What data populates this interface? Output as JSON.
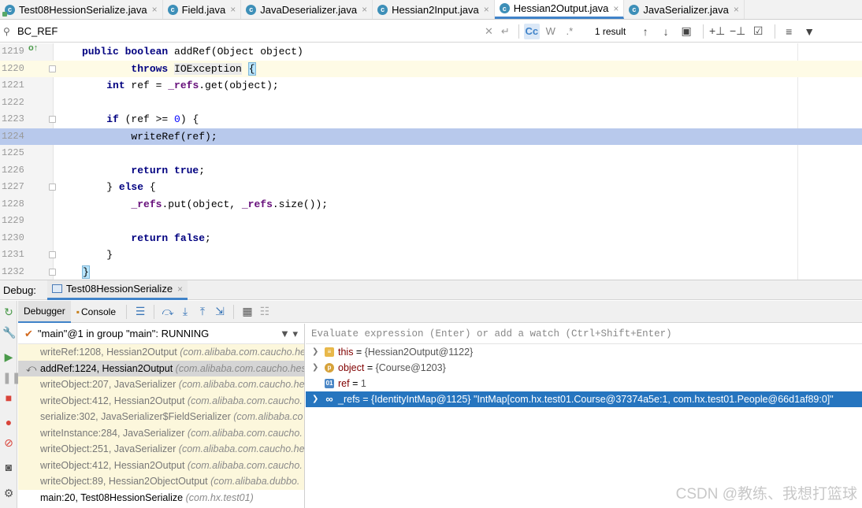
{
  "tabs": [
    {
      "label": "Test08HessionSerialize.java",
      "icon": "class-run-icon",
      "active": false
    },
    {
      "label": "Field.java",
      "icon": "class-icon",
      "active": false
    },
    {
      "label": "JavaDeserializer.java",
      "icon": "class-icon",
      "active": false
    },
    {
      "label": "Hessian2Input.java",
      "icon": "class-icon",
      "active": false
    },
    {
      "label": "Hessian2Output.java",
      "icon": "class-icon",
      "active": true
    },
    {
      "label": "JavaSerializer.java",
      "icon": "class-icon",
      "active": false
    }
  ],
  "search": {
    "value": "BC_REF",
    "results": "1 result",
    "match_case": "Cc",
    "words": "W",
    "regex": ".*"
  },
  "editor": {
    "lines": [
      {
        "num": "1219",
        "text": "    public boolean addRef(Object object)"
      },
      {
        "num": "1220",
        "text": "            throws IOException {"
      },
      {
        "num": "1221",
        "text": "        int ref = _refs.get(object);"
      },
      {
        "num": "1222",
        "text": ""
      },
      {
        "num": "1223",
        "text": "        if (ref >= 0) {"
      },
      {
        "num": "1224",
        "text": "            writeRef(ref);"
      },
      {
        "num": "1225",
        "text": ""
      },
      {
        "num": "1226",
        "text": "            return true;"
      },
      {
        "num": "1227",
        "text": "        } else {"
      },
      {
        "num": "1228",
        "text": "            _refs.put(object, _refs.size());"
      },
      {
        "num": "1229",
        "text": ""
      },
      {
        "num": "1230",
        "text": "            return false;"
      },
      {
        "num": "1231",
        "text": "        }"
      },
      {
        "num": "1232",
        "text": "    }"
      }
    ]
  },
  "debug": {
    "label": "Debug:",
    "session": "Test08HessionSerialize",
    "tab_debugger": "Debugger",
    "tab_console": "Console",
    "thread": "\"main\"@1 in group \"main\": RUNNING",
    "eval_placeholder": "Evaluate expression (Enter) or add a watch (Ctrl+Shift+Enter)"
  },
  "frames": [
    {
      "method": "writeRef:1208, Hessian2Output",
      "pkg": "(com.alibaba.com.caucho.he",
      "kind": "lib"
    },
    {
      "method": "addRef:1224, Hessian2Output",
      "pkg": "(com.alibaba.com.caucho.hes",
      "kind": "current"
    },
    {
      "method": "writeObject:207, JavaSerializer",
      "pkg": "(com.alibaba.com.caucho.he",
      "kind": "lib"
    },
    {
      "method": "writeObject:412, Hessian2Output",
      "pkg": "(com.alibaba.com.caucho.",
      "kind": "lib"
    },
    {
      "method": "serialize:302, JavaSerializer$FieldSerializer",
      "pkg": "(com.alibaba.co",
      "kind": "lib"
    },
    {
      "method": "writeInstance:284, JavaSerializer",
      "pkg": "(com.alibaba.com.caucho.",
      "kind": "lib"
    },
    {
      "method": "writeObject:251, JavaSerializer",
      "pkg": "(com.alibaba.com.caucho.he",
      "kind": "lib"
    },
    {
      "method": "writeObject:412, Hessian2Output",
      "pkg": "(com.alibaba.com.caucho.",
      "kind": "lib"
    },
    {
      "method": "writeObject:89, Hessian2ObjectOutput",
      "pkg": "(com.alibaba.dubbo.",
      "kind": "lib"
    },
    {
      "method": "main:20, Test08HessionSerialize",
      "pkg": "(com.hx.test01)",
      "kind": "user"
    }
  ],
  "variables": [
    {
      "name": "this",
      "value": "{Hessian2Output@1122}",
      "icon": "field-icon",
      "expandable": true,
      "selected": false
    },
    {
      "name": "object",
      "value": "{Course@1203}",
      "icon": "parameter-icon",
      "expandable": true,
      "selected": false
    },
    {
      "name": "ref",
      "value": "1",
      "icon": "primitive-icon",
      "expandable": false,
      "selected": false
    },
    {
      "name": "_refs",
      "value": "{IdentityIntMap@1125} \"IntMap[com.hx.test01.Course@37374a5e:1, com.hx.test01.People@66d1af89:0]\"",
      "icon": "watch-icon",
      "expandable": true,
      "selected": true
    }
  ],
  "watermark": "CSDN @教练、我想打篮球",
  "colors": {
    "accent": "#4083c9",
    "exec_line": "#b8c9ec",
    "selected_var": "#2675bf",
    "lib_frame": "#fcf7dc"
  }
}
